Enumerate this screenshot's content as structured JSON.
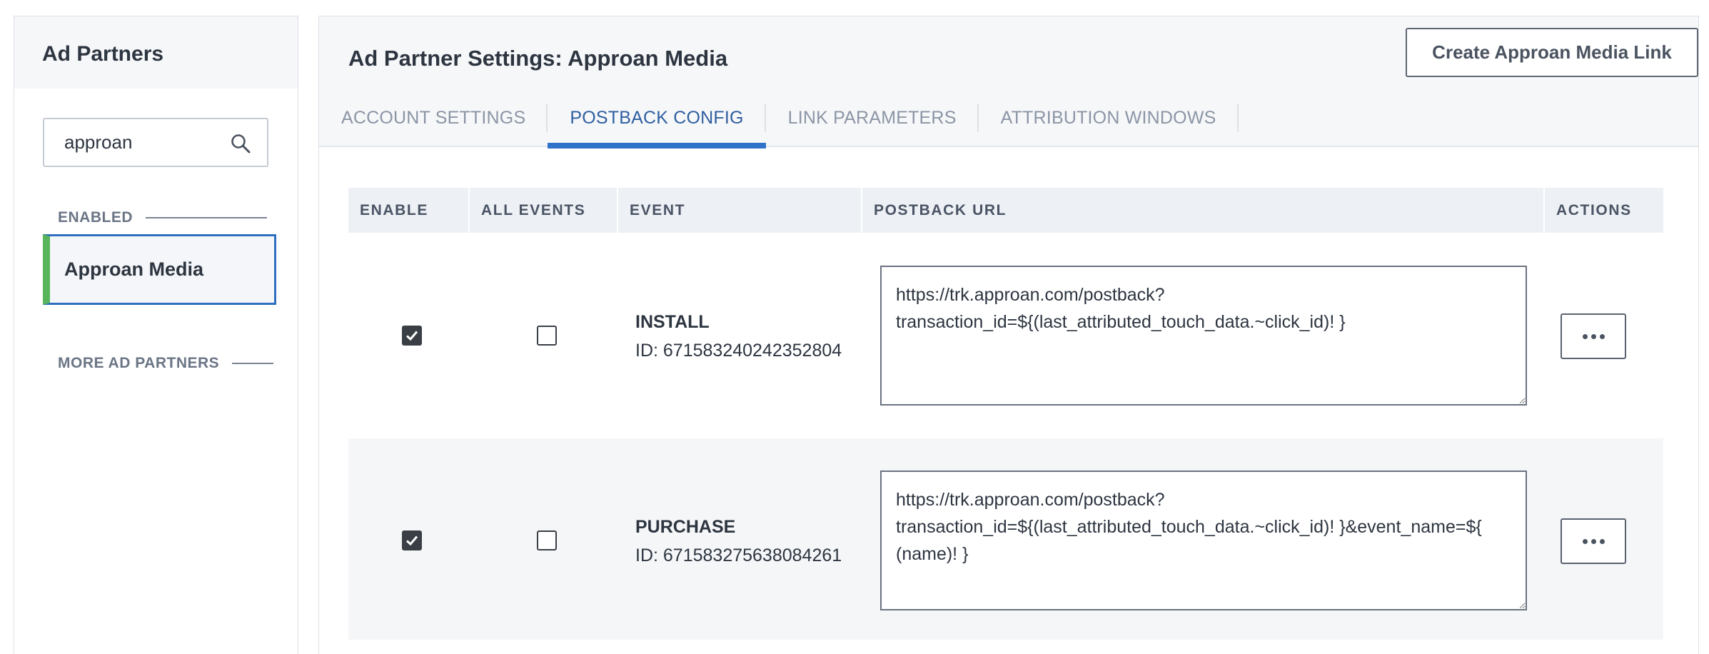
{
  "sidebar": {
    "title": "Ad Partners",
    "search": {
      "value": "approan",
      "placeholder": ""
    },
    "enabled_label": "ENABLED",
    "enabled_items": [
      {
        "label": "Approan Media",
        "selected": true
      }
    ],
    "more_label": "MORE AD PARTNERS"
  },
  "main": {
    "title": "Ad Partner Settings: Approan Media",
    "create_button": "Create Approan Media Link",
    "tabs": [
      {
        "label": "ACCOUNT SETTINGS",
        "active": false
      },
      {
        "label": "POSTBACK CONFIG",
        "active": true
      },
      {
        "label": "LINK PARAMETERS",
        "active": false
      },
      {
        "label": "ATTRIBUTION WINDOWS",
        "active": false
      }
    ]
  },
  "table": {
    "columns": [
      "ENABLE",
      "ALL EVENTS",
      "EVENT",
      "POSTBACK URL",
      "ACTIONS"
    ],
    "rows": [
      {
        "enabled": true,
        "all_events": false,
        "event": "INSTALL",
        "event_id": "ID: 671583240242352804",
        "postback_url": "https://trk.approan.com/postback?transaction_id=${(last_attributed_touch_data.~click_id)! }"
      },
      {
        "enabled": true,
        "all_events": false,
        "event": "PURCHASE",
        "event_id": "ID: 671583275638084261",
        "postback_url": "https://trk.approan.com/postback?transaction_id=${(last_attributed_touch_data.~click_id)! }&event_name=${ (name)! }"
      }
    ]
  },
  "colors": {
    "accent_blue": "#2f72c9",
    "enabled_green": "#58b55c",
    "checkbox_dark": "#3a3f46"
  }
}
